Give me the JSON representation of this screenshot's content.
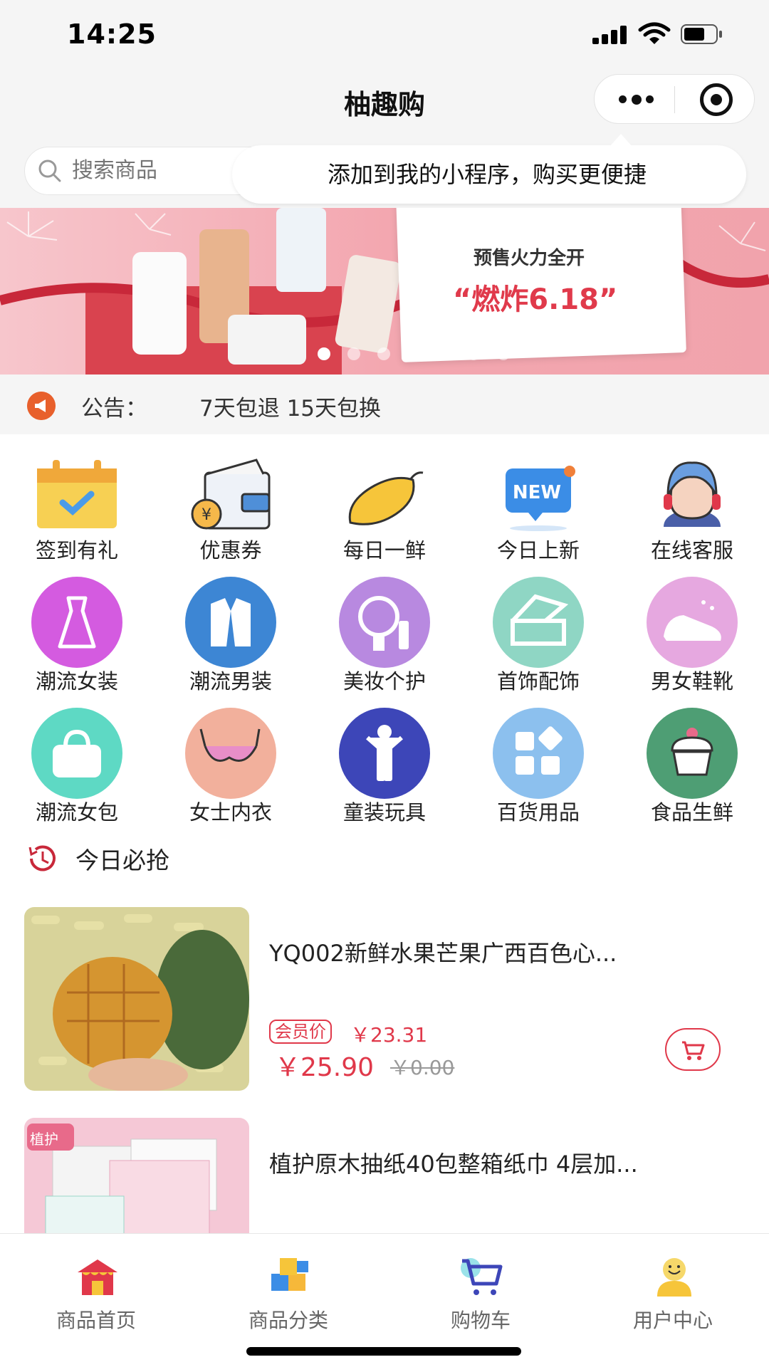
{
  "status_bar": {
    "time": "14:25"
  },
  "nav": {
    "title": "柚趣购"
  },
  "search": {
    "placeholder": "搜索商品"
  },
  "tooltip": {
    "text": "添加到我的小程序，购买更便捷"
  },
  "banner": {
    "subtitle": "预售火力全开",
    "headline": "“燃炸6.18”",
    "dot_count": 7,
    "active_dot": 0
  },
  "notice": {
    "label": "公告：",
    "text": "7天包退 15天包换"
  },
  "categories": [
    {
      "label": "签到有礼",
      "icon": "calendar-check-icon"
    },
    {
      "label": "优惠券",
      "icon": "coupon-wallet-icon"
    },
    {
      "label": "每日一鲜",
      "icon": "mango-icon"
    },
    {
      "label": "今日上新",
      "icon": "new-badge-icon"
    },
    {
      "label": "在线客服",
      "icon": "headset-agent-icon"
    },
    {
      "label": "潮流女装",
      "icon": "dress-icon",
      "color": "#d45be0"
    },
    {
      "label": "潮流男装",
      "icon": "suit-icon",
      "color": "#3d86d4"
    },
    {
      "label": "美妆个护",
      "icon": "makeup-icon",
      "color": "#b889e0"
    },
    {
      "label": "首饰配饰",
      "icon": "jewelry-box-icon",
      "color": "#8fd6c4"
    },
    {
      "label": "男女鞋靴",
      "icon": "shoes-icon",
      "color": "#e6a8e0"
    },
    {
      "label": "潮流女包",
      "icon": "handbag-icon",
      "color": "#5ed9c4"
    },
    {
      "label": "女士内衣",
      "icon": "bra-icon",
      "color": "#f2b09c"
    },
    {
      "label": "童装玩具",
      "icon": "child-icon",
      "color": "#3d46b8"
    },
    {
      "label": "百货用品",
      "icon": "grid-shapes-icon",
      "color": "#8cc0ee"
    },
    {
      "label": "食品生鲜",
      "icon": "cake-icon",
      "color": "#4e9e74"
    }
  ],
  "section": {
    "title": "今日必抢"
  },
  "products": [
    {
      "title": "YQ002新鲜水果芒果广西百色心...",
      "member_tag": "会员价",
      "member_price": "￥23.31",
      "price": "￥25.90",
      "original_price": "￥0.00"
    },
    {
      "title": "植护原木抽纸40包整箱纸巾 4层加...",
      "badge": "植护"
    }
  ],
  "tabbar": [
    {
      "label": "商品首页",
      "icon": "home-shop-icon"
    },
    {
      "label": "商品分类",
      "icon": "category-boxes-icon"
    },
    {
      "label": "购物车",
      "icon": "cart-icon"
    },
    {
      "label": "用户中心",
      "icon": "user-smile-icon"
    }
  ],
  "colors": {
    "accent": "#e0384a",
    "notice_icon": "#e8602c"
  }
}
